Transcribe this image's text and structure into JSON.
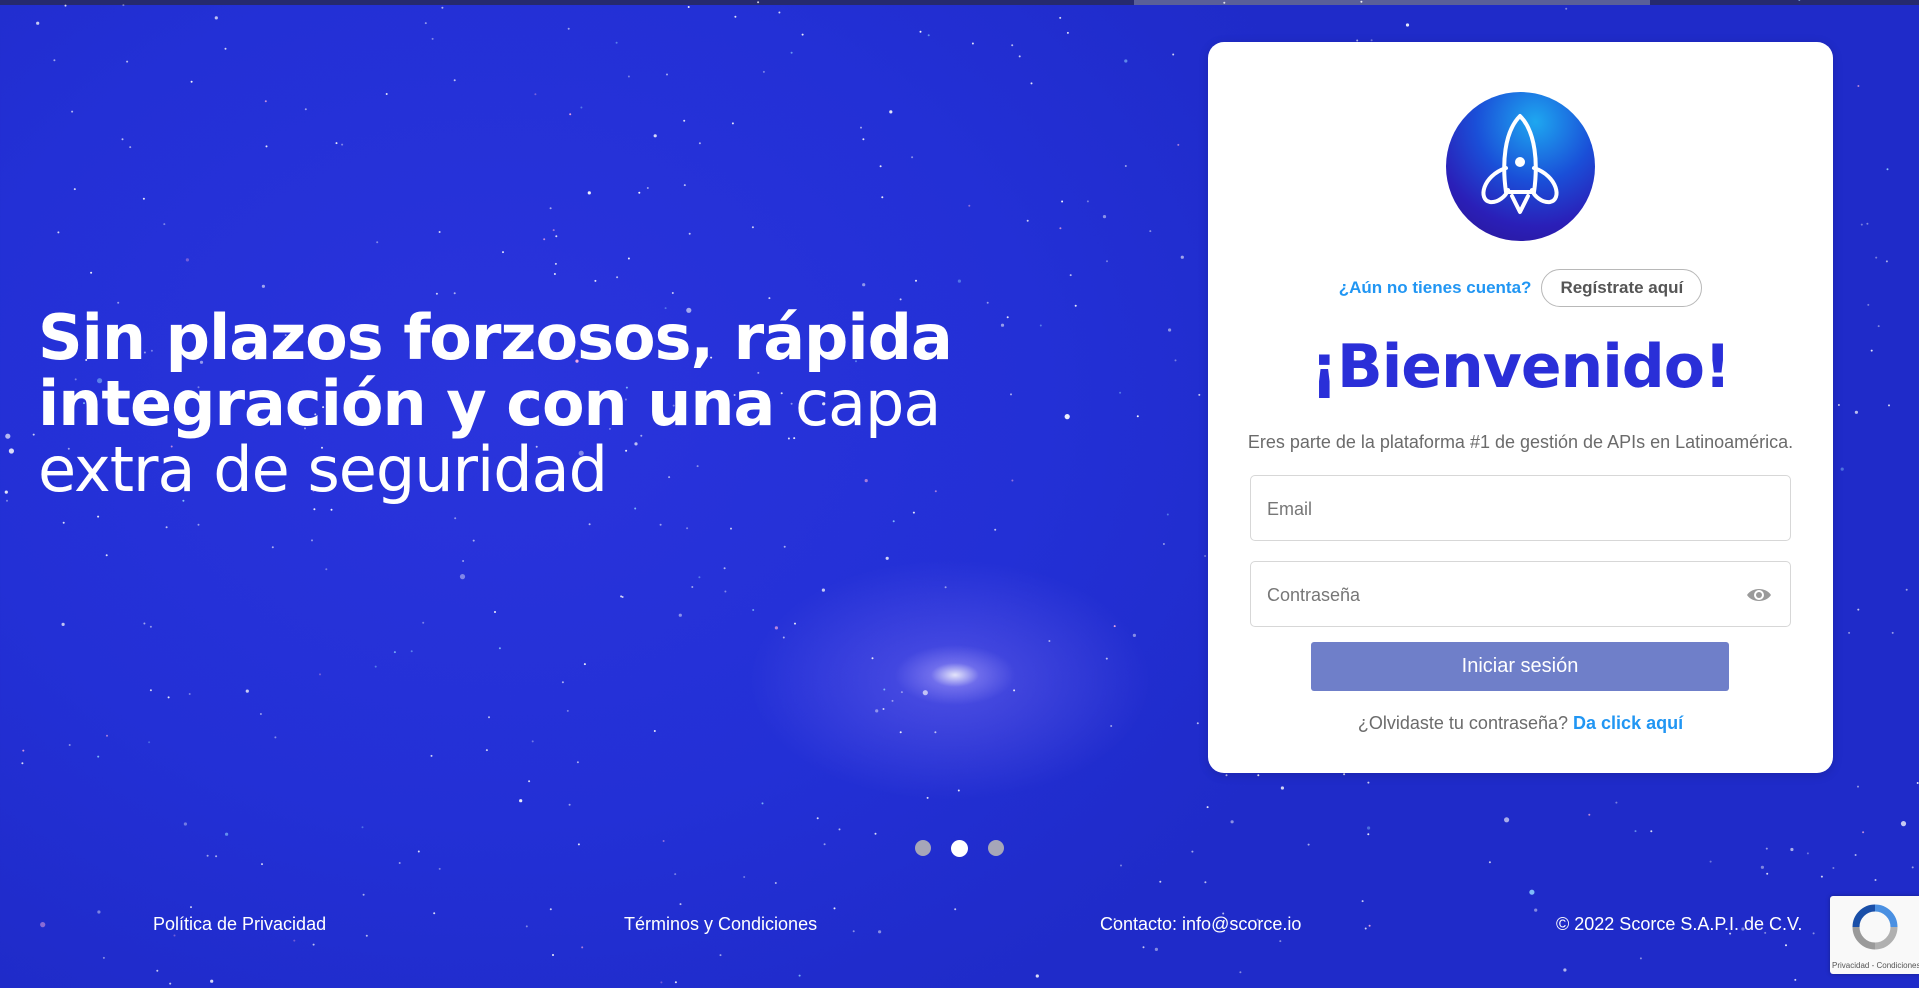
{
  "hero": {
    "line1_bold": "Sin plazos forzosos, rápida",
    "line2_bold": "integración y con una ",
    "line2_light": "capa",
    "line3_light": "extra de seguridad"
  },
  "login": {
    "signup_question": "¿Aún no tienes cuenta?",
    "signup_button": "Regístrate aquí",
    "title": "¡Bienvenido!",
    "subtitle": "Eres parte de la plataforma #1 de gestión de APIs en Latinoamérica.",
    "email_placeholder": "Email",
    "password_placeholder": "Contraseña",
    "login_button": "Iniciar sesión",
    "forgot_text": "¿Olvidaste tu contraseña?",
    "forgot_link": "Da click aquí"
  },
  "carousel": {
    "count": 3,
    "active_index": 1
  },
  "footer": {
    "privacy": "Política de Privacidad",
    "terms": "Términos y Condiciones",
    "contact": "Contacto: info@scorce.io",
    "copyright": "© 2022 Scorce S.A.P.I. de C.V."
  },
  "recaptcha": {
    "text": "Privacidad - Condiciones"
  },
  "icons": {
    "logo": "rocket-icon",
    "password_toggle": "eye-icon",
    "recaptcha": "recaptcha-icon"
  },
  "colors": {
    "background": "#2330d6",
    "title": "#2a2fd8",
    "link": "#2196f3",
    "login_button": "#6f7fc9"
  }
}
